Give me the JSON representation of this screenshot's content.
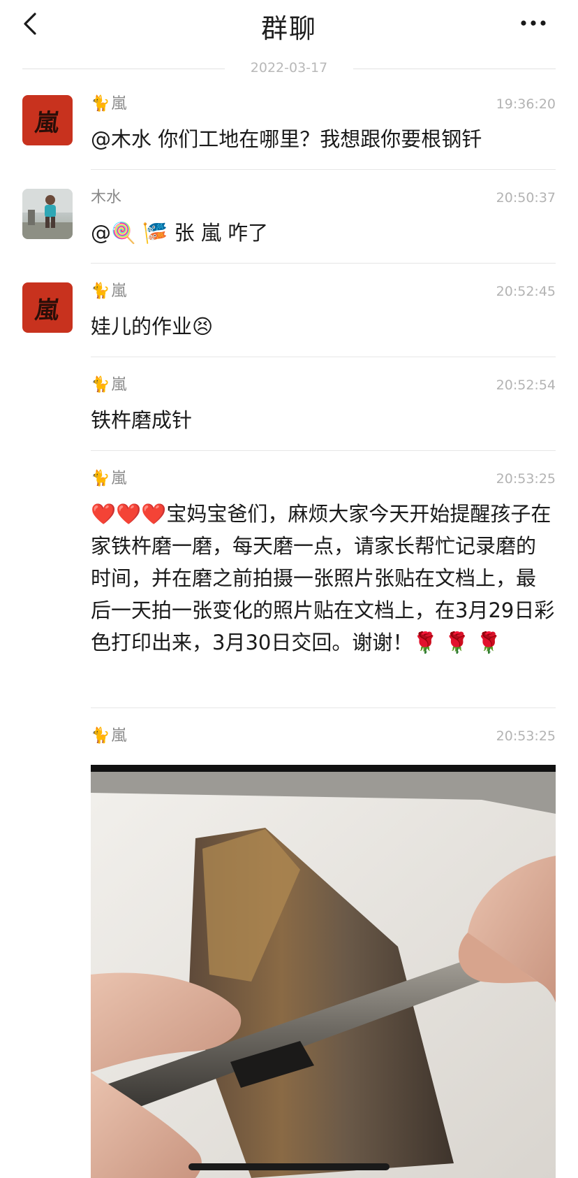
{
  "header": {
    "title": "群聊",
    "back_icon": "chevron-left-icon",
    "more_icon": "ellipsis-icon"
  },
  "date_separator": "2022-03-17",
  "messages": [
    {
      "sender": "嵐",
      "sender_icon": "🐈",
      "time": "19:36:20",
      "text": "@木水 你们工地在哪里？我想跟你要根钢钎"
    },
    {
      "sender": "木水",
      "time": "20:50:37",
      "text": "@🍭 🎏 张 嵐 咋了"
    },
    {
      "sender": "嵐",
      "sender_icon": "🐈",
      "time": "20:52:45",
      "text": "娃儿的作业😣"
    },
    {
      "sender": "嵐",
      "sender_icon": "🐈",
      "time": "20:52:54",
      "text": "铁杵磨成针"
    },
    {
      "sender": "嵐",
      "sender_icon": "🐈",
      "time": "20:53:25",
      "text": "❤️❤️❤️宝妈宝爸们，麻烦大家今天开始提醒孩子在家铁杵磨一磨，每天磨一点，请家长帮忙记录磨的时间，并在磨之前拍摄一张照片张贴在文档上，最后一天拍一张变化的照片贴在文档上，在3月29日彩色打印出来，3月30日交回。谢谢！🌹 🌹 🌹"
    },
    {
      "sender": "嵐",
      "sender_icon": "🐈",
      "time": "20:53:25"
    }
  ],
  "avatars": {
    "lan_seal_text": "嵐",
    "lan_seal_color": "#c8321e"
  }
}
